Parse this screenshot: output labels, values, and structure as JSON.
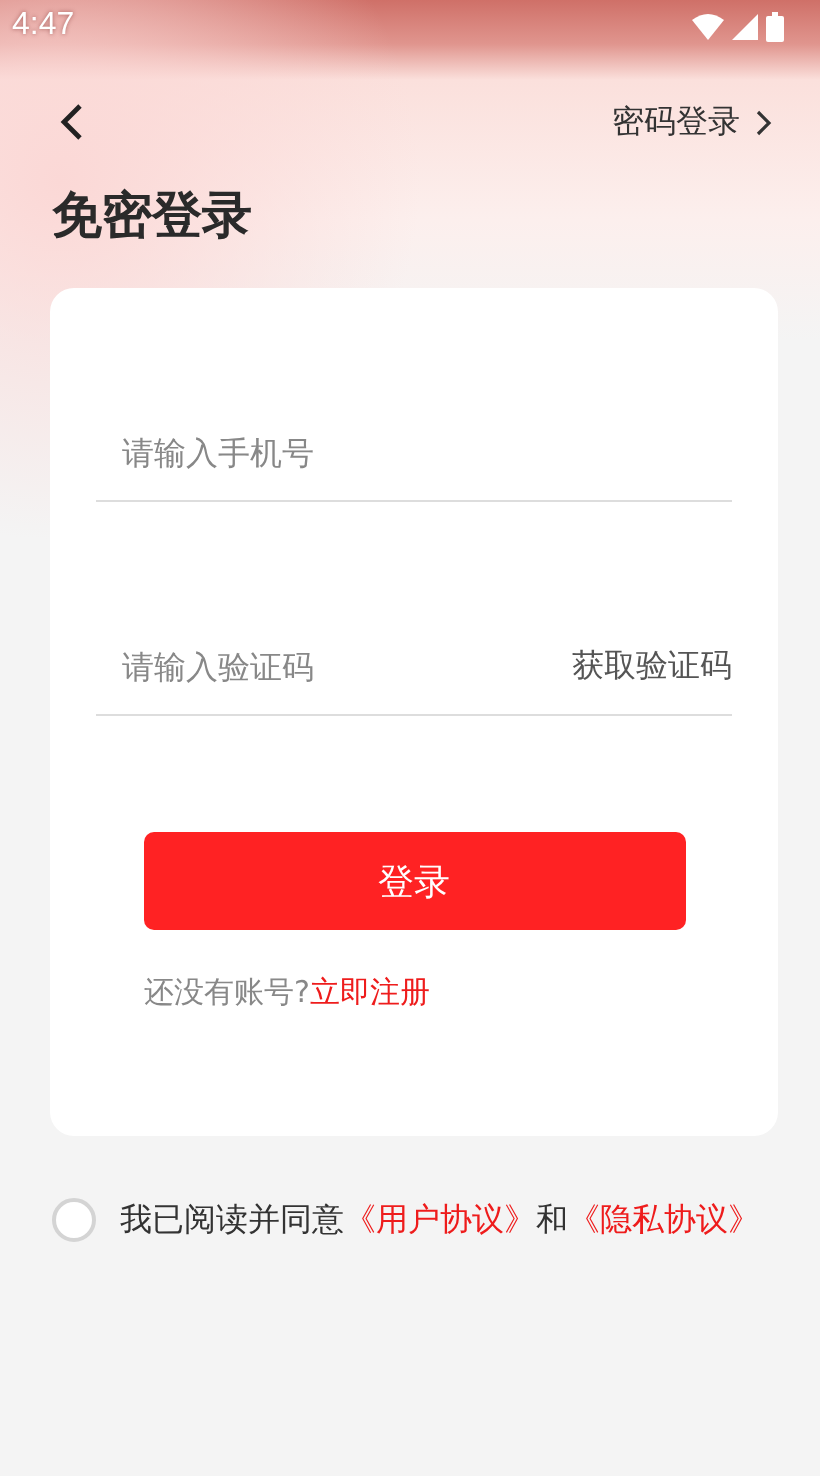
{
  "status_bar": {
    "time": "4:47"
  },
  "nav": {
    "switch_link": "密码登录"
  },
  "title": "免密登录",
  "form": {
    "phone_field": {
      "placeholder": "请输入手机号"
    },
    "code_field": {
      "placeholder": "请输入验证码"
    },
    "get_code_button": "获取验证码",
    "submit_button": "登录",
    "signup_prompt": "还没有账号?",
    "signup_link": "立即注册"
  },
  "agreement": {
    "checked": false,
    "text": "我已阅读并同意",
    "links": [
      "《用户协议》",
      "《隐私协议》"
    ],
    "joiner": "和"
  }
}
